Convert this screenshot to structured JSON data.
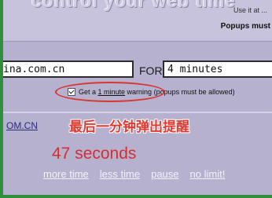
{
  "header": {
    "title_fragment": "control your web time",
    "top_right_line1": "Use it at ...",
    "top_right_line2": "Popups must"
  },
  "form": {
    "site_value": "ina.com.cn",
    "for_label": "FOR",
    "time_value": "4 minutes",
    "warning_prefix": "Get a ",
    "warning_link": "1 minute",
    "warning_suffix": " warning (popups must be allowed)"
  },
  "annotation": {
    "text": "最后一分钟弹出提醒"
  },
  "status": {
    "domain_link": "OM.CN",
    "countdown": "47 seconds"
  },
  "links": {
    "more_time": "more time",
    "less_time": "less time",
    "pause": "pause",
    "no_limit": "no limit!"
  },
  "colors": {
    "accent_green": "#2f8f3a",
    "annotation_red": "#e23a30",
    "panel_bg": "#b7b1d0"
  }
}
